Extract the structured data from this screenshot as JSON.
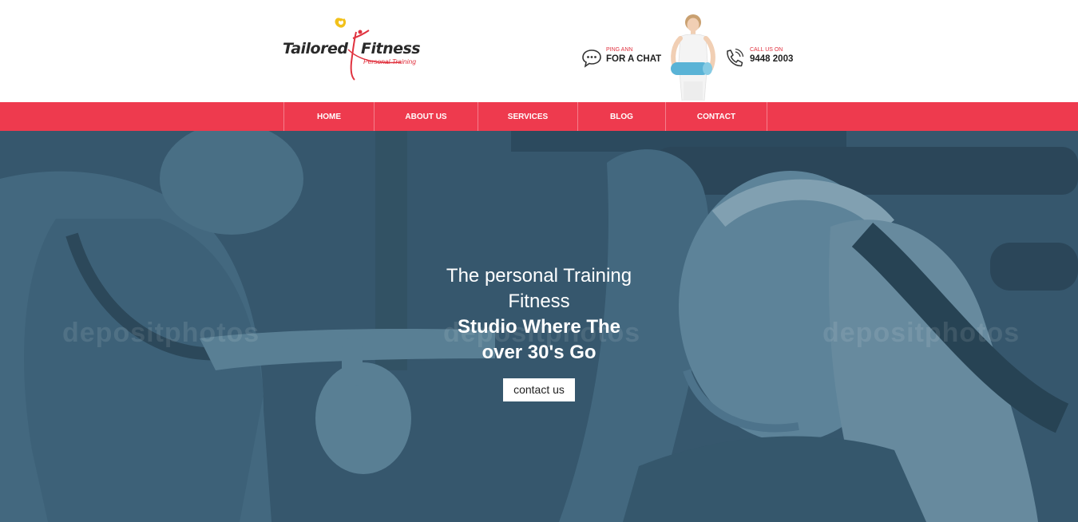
{
  "logo": {
    "word1": "Tailored",
    "word2": "Fitness",
    "tagline": "Personal Training"
  },
  "chat": {
    "small": "PING ANN",
    "big": "FOR A CHAT",
    "icon": "chat-bubble-icon"
  },
  "call": {
    "small": "CALL US ON",
    "big": "9448 2003",
    "icon": "phone-icon"
  },
  "nav": {
    "items": [
      {
        "label": "HOME"
      },
      {
        "label": "ABOUT US"
      },
      {
        "label": "SERVICES"
      },
      {
        "label": "BLOG"
      },
      {
        "label": "CONTACT"
      }
    ]
  },
  "hero": {
    "line1": "The personal Training",
    "line2": "Fitness",
    "line3": "Studio Where The",
    "line4": "over 30's Go",
    "button": "contact us",
    "watermark": "depositphotos"
  },
  "colors": {
    "accent": "#ee3a4e",
    "hero_tint": "#3b5b70"
  }
}
